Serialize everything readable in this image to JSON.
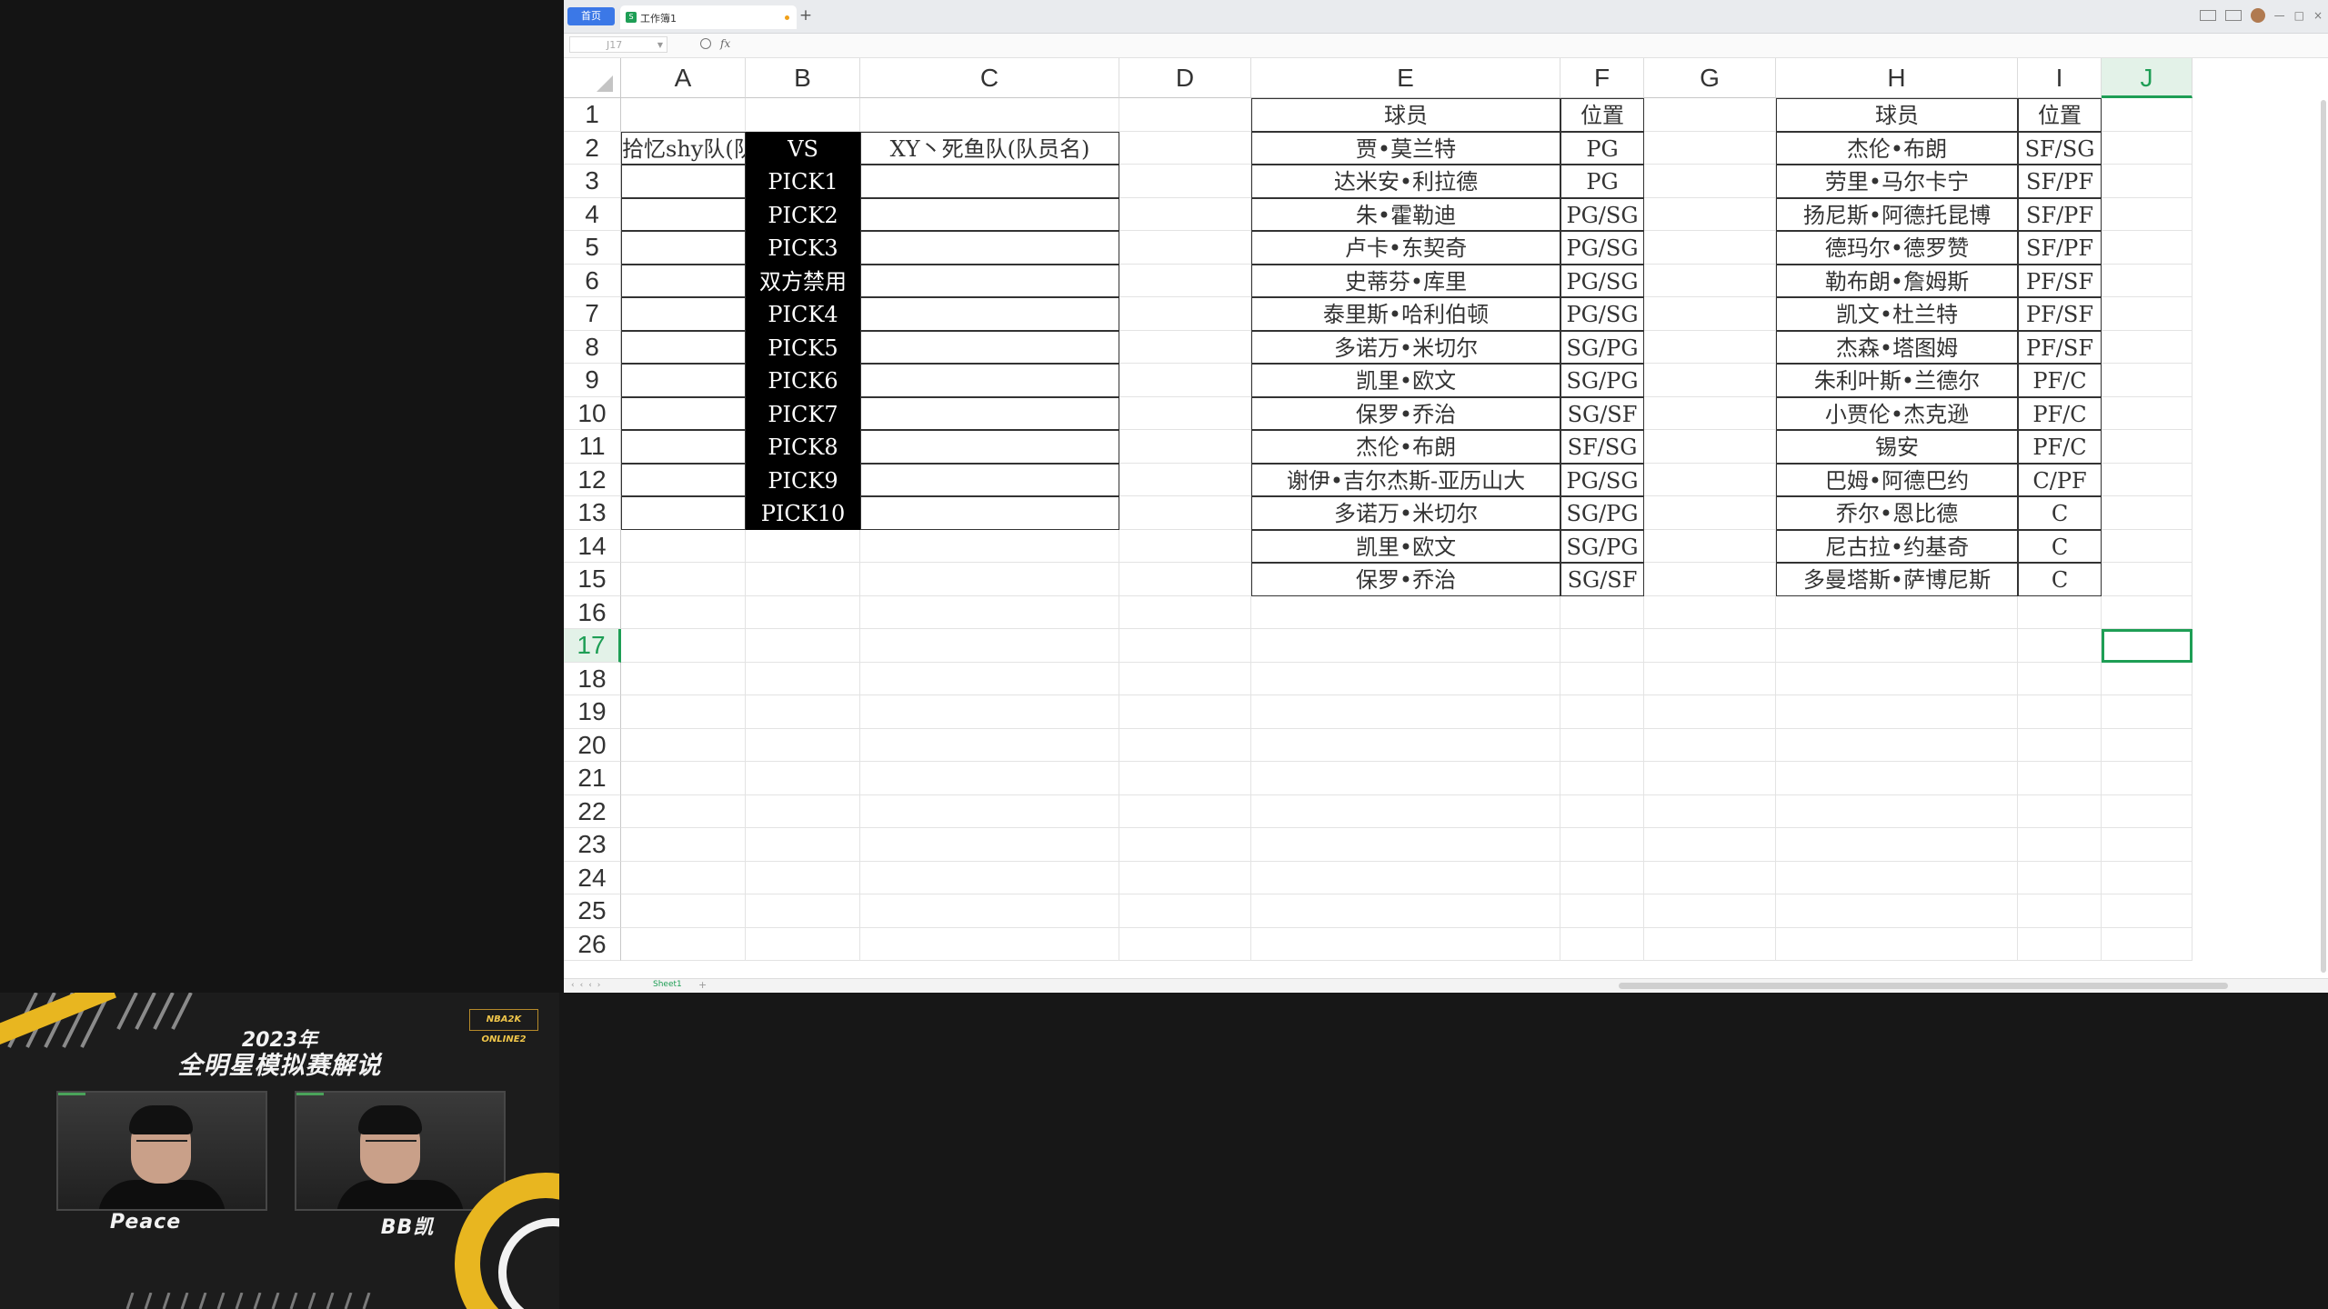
{
  "tabbar": {
    "home_label": "首页",
    "doc_name": "工作簿1",
    "new_tab_label": "+"
  },
  "formula_bar": {
    "cell_ref": "J17",
    "fx_label": "fx",
    "formula": ""
  },
  "columns": [
    "A",
    "B",
    "C",
    "D",
    "E",
    "F",
    "G",
    "H",
    "I",
    "J"
  ],
  "rows": [
    "1",
    "2",
    "3",
    "4",
    "5",
    "6",
    "7",
    "8",
    "9",
    "10",
    "11",
    "12",
    "13",
    "14",
    "15",
    "16",
    "17",
    "18",
    "19",
    "20",
    "21",
    "22",
    "23",
    "24",
    "25",
    "26"
  ],
  "active_cell": {
    "column": "J",
    "row": "17"
  },
  "draft_table": {
    "team_a": "拾忆shy队(队员名)",
    "vs": "VS",
    "team_c": "XY丶死鱼队(队员名)",
    "picks": [
      "PICK1",
      "PICK2",
      "PICK3",
      "双方禁用",
      "PICK4",
      "PICK5",
      "PICK6",
      "PICK7",
      "PICK8",
      "PICK9",
      "PICK10"
    ]
  },
  "players_left": {
    "header_player": "球员",
    "header_pos": "位置",
    "rows": [
      {
        "name": "贾•莫兰特",
        "pos": "PG"
      },
      {
        "name": "达米安•利拉德",
        "pos": "PG"
      },
      {
        "name": "朱•霍勒迪",
        "pos": "PG/SG"
      },
      {
        "name": "卢卡•东契奇",
        "pos": "PG/SG"
      },
      {
        "name": "史蒂芬•库里",
        "pos": "PG/SG"
      },
      {
        "name": "泰里斯•哈利伯顿",
        "pos": "PG/SG"
      },
      {
        "name": "多诺万•米切尔",
        "pos": "SG/PG"
      },
      {
        "name": "凯里•欧文",
        "pos": "SG/PG"
      },
      {
        "name": "保罗•乔治",
        "pos": "SG/SF"
      },
      {
        "name": "杰伦•布朗",
        "pos": "SF/SG"
      },
      {
        "name": "谢伊•吉尔杰斯-亚历山大",
        "pos": "PG/SG"
      },
      {
        "name": "多诺万•米切尔",
        "pos": "SG/PG"
      },
      {
        "name": "凯里•欧文",
        "pos": "SG/PG"
      },
      {
        "name": "保罗•乔治",
        "pos": "SG/SF"
      }
    ]
  },
  "players_right": {
    "header_player": "球员",
    "header_pos": "位置",
    "rows": [
      {
        "name": "杰伦•布朗",
        "pos": "SF/SG"
      },
      {
        "name": "劳里•马尔卡宁",
        "pos": "SF/PF"
      },
      {
        "name": "扬尼斯•阿德托昆博",
        "pos": "SF/PF"
      },
      {
        "name": "德玛尔•德罗赞",
        "pos": "SF/PF"
      },
      {
        "name": "勒布朗•詹姆斯",
        "pos": "PF/SF"
      },
      {
        "name": "凯文•杜兰特",
        "pos": "PF/SF"
      },
      {
        "name": "杰森•塔图姆",
        "pos": "PF/SF"
      },
      {
        "name": "朱利叶斯•兰德尔",
        "pos": "PF/C"
      },
      {
        "name": "小贾伦•杰克逊",
        "pos": "PF/C"
      },
      {
        "name": "锡安",
        "pos": "PF/C"
      },
      {
        "name": "巴姆•阿德巴约",
        "pos": "C/PF"
      },
      {
        "name": "乔尔•恩比德",
        "pos": "C"
      },
      {
        "name": "尼古拉•约基奇",
        "pos": "C"
      },
      {
        "name": "多曼塔斯•萨博尼斯",
        "pos": "C"
      }
    ]
  },
  "sheet_tab": "Sheet1",
  "overlay": {
    "title_line1": "2023年",
    "title_line2": "全明星模拟赛解说",
    "logo_text": "NBA2K ONLINE2",
    "commentator_left": "Peace",
    "commentator_right": "BB凯"
  },
  "colors": {
    "accent_green": "#1e9e55",
    "header_black": "#000000",
    "overlay_gold": "#e8b620"
  }
}
